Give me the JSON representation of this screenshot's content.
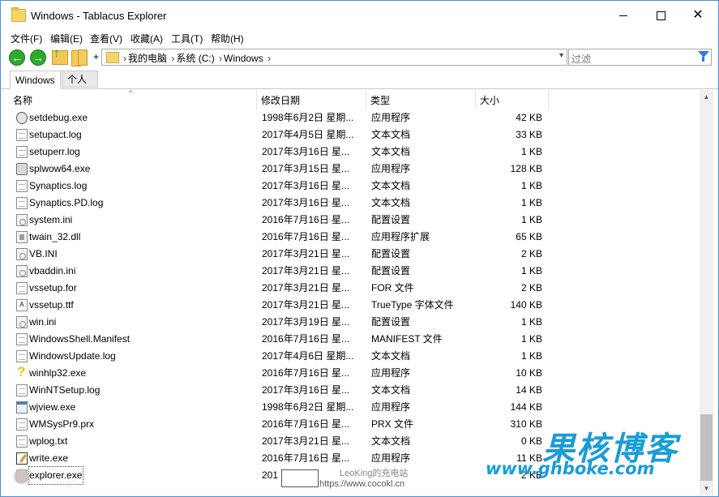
{
  "window": {
    "title": "Windows - Tablacus Explorer",
    "minimize_glyph": "",
    "close_glyph": "✕"
  },
  "menu": [
    "文件(F)",
    "编辑(E)",
    "查看(V)",
    "收藏(A)",
    "工具(T)",
    "帮助(H)"
  ],
  "toolbar": {
    "back_glyph": "←",
    "forward_glyph": "→",
    "plus": "+"
  },
  "address": {
    "crumbs": [
      "我的电脑",
      "系统 (C:)",
      "Windows"
    ],
    "sep": "›",
    "dropdown_glyph": "▼"
  },
  "filter": {
    "placeholder": "过滤"
  },
  "tabs": [
    "Windows",
    "个人"
  ],
  "columns": {
    "name": "名称",
    "date": "修改日期",
    "type": "类型",
    "size": "大小",
    "sort_glyph": "^"
  },
  "files": [
    {
      "name": "setdebug.exe",
      "date": "1998年6月2日 星期...",
      "type": "应用程序",
      "size": "42 KB",
      "icon": "gear"
    },
    {
      "name": "setupact.log",
      "date": "2017年4月5日 星期...",
      "type": "文本文档",
      "size": "33 KB",
      "icon": "doc"
    },
    {
      "name": "setuperr.log",
      "date": "2017年3月16日 星...",
      "type": "文本文档",
      "size": "1 KB",
      "icon": "doc"
    },
    {
      "name": "splwow64.exe",
      "date": "2017年3月15日 星...",
      "type": "应用程序",
      "size": "128 KB",
      "icon": "printer"
    },
    {
      "name": "Synaptics.log",
      "date": "2017年3月16日 星...",
      "type": "文本文档",
      "size": "1 KB",
      "icon": "doc"
    },
    {
      "name": "Synaptics.PD.log",
      "date": "2017年3月16日 星...",
      "type": "文本文档",
      "size": "1 KB",
      "icon": "doc"
    },
    {
      "name": "system.ini",
      "date": "2016年7月16日 星...",
      "type": "配置设置",
      "size": "1 KB",
      "icon": "ini"
    },
    {
      "name": "twain_32.dll",
      "date": "2016年7月16日 星...",
      "type": "应用程序扩展",
      "size": "65 KB",
      "icon": "dll"
    },
    {
      "name": "VB.INI",
      "date": "2017年3月21日 星...",
      "type": "配置设置",
      "size": "2 KB",
      "icon": "ini"
    },
    {
      "name": "vbaddin.ini",
      "date": "2017年3月21日 星...",
      "type": "配置设置",
      "size": "1 KB",
      "icon": "ini"
    },
    {
      "name": "vssetup.for",
      "date": "2017年3月21日 星...",
      "type": "FOR 文件",
      "size": "2 KB",
      "icon": "doc"
    },
    {
      "name": "vssetup.ttf",
      "date": "2017年3月21日 星...",
      "type": "TrueType 字体文件",
      "size": "140 KB",
      "icon": "ttf"
    },
    {
      "name": "win.ini",
      "date": "2017年3月19日 星...",
      "type": "配置设置",
      "size": "1 KB",
      "icon": "ini"
    },
    {
      "name": "WindowsShell.Manifest",
      "date": "2016年7月16日 星...",
      "type": "MANIFEST 文件",
      "size": "1 KB",
      "icon": "doc"
    },
    {
      "name": "WindowsUpdate.log",
      "date": "2017年4月6日 星期...",
      "type": "文本文档",
      "size": "1 KB",
      "icon": "doc"
    },
    {
      "name": "winhlp32.exe",
      "date": "2016年7月16日 星...",
      "type": "应用程序",
      "size": "10 KB",
      "icon": "help"
    },
    {
      "name": "WinNTSetup.log",
      "date": "2017年3月16日 星...",
      "type": "文本文档",
      "size": "14 KB",
      "icon": "doc"
    },
    {
      "name": "wjview.exe",
      "date": "1998年6月2日 星期...",
      "type": "应用程序",
      "size": "144 KB",
      "icon": "exe"
    },
    {
      "name": "WMSysPr9.prx",
      "date": "2016年7月16日 星...",
      "type": "PRX 文件",
      "size": "310 KB",
      "icon": "doc"
    },
    {
      "name": "wplog.txt",
      "date": "2017年3月21日 星...",
      "type": "文本文档",
      "size": "0 KB",
      "icon": "doc"
    },
    {
      "name": "write.exe",
      "date": "2016年7月16日 星...",
      "type": "应用程序",
      "size": "11 KB",
      "icon": "write"
    },
    {
      "name": "explorer.exe",
      "date": "201",
      "type": "",
      "size": "2 KB",
      "icon": "explorer",
      "selected": true
    }
  ],
  "scrollbar": {
    "up_glyph": "▲",
    "down_glyph": "▼"
  },
  "watermark": {
    "cn": "果核博客",
    "url": "www.ghboke.com",
    "small1": "LeoKing的充电站",
    "small2": "https://www.cocokl.cn"
  }
}
